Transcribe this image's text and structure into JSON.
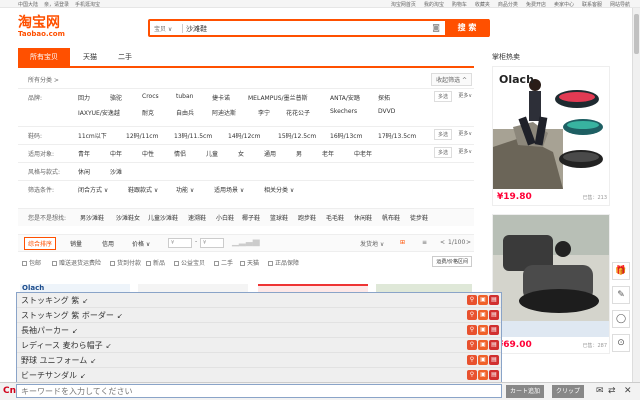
{
  "topbar": {
    "left": [
      "中国大陆",
      "亲，请登录",
      "手机逛淘宝"
    ],
    "right": [
      "淘宝网首页",
      "我的淘宝",
      "购物车",
      "收藏夹",
      "商品分类",
      "免费开店",
      "卖家中心",
      "联系客服",
      "网站导航"
    ]
  },
  "logo": {
    "line1": "淘宝网",
    "line2": "Taobao.com"
  },
  "search": {
    "category": "宝贝",
    "query": "沙滩鞋",
    "button": "搜 索"
  },
  "tabs": [
    {
      "label": "所有宝贝"
    },
    {
      "label": "天猫"
    },
    {
      "label": "二手"
    }
  ],
  "hot": {
    "title": "掌柜热卖"
  },
  "filter": {
    "crumb": "所有分类 >",
    "collapse": "收起筛选 ^",
    "multi": "多选",
    "more": "更多",
    "rows": [
      {
        "label": "品牌:",
        "values": [
          "回力",
          "骆驼",
          "Crocs",
          "tuban",
          "捷卡诺",
          "MELAMPUS/墨兰普斯",
          "ANTA/安踏",
          "探拓"
        ]
      },
      {
        "label": "",
        "values": [
          "IAXYUE/安逸越",
          "耐克",
          "自由兵",
          "阿迪达斯",
          "李宁",
          "花花公子",
          "Skechers",
          "DVVD"
        ]
      },
      {
        "label": "鞋码:",
        "values": [
          "11cm以下",
          "12码/11cm",
          "13码/11.5cm",
          "14码/12cm",
          "15码/12.5cm",
          "16码/13cm",
          "17码/13.5cm"
        ]
      },
      {
        "label": "适用对象:",
        "values": [
          "青年",
          "中年",
          "中性",
          "情侣",
          "儿童",
          "女",
          "通用",
          "男",
          "老年",
          "中老年"
        ]
      },
      {
        "label": "风格与款式:",
        "values": [
          "休闲",
          "沙滩"
        ]
      },
      {
        "label": "筛选条件:",
        "values": [
          "闭合方式 ∨",
          "鞋跟款式 ∨",
          "功能 ∨",
          "适用场景 ∨",
          "相关分类 ∨"
        ]
      },
      {
        "label": "您是不是想找:",
        "values": [
          "男沙滩鞋",
          "沙滩鞋女",
          "儿童沙滩鞋",
          "速溯鞋",
          "小白鞋",
          "椰子鞋",
          "篮球鞋",
          "跑步鞋",
          "毛毛鞋",
          "休闲鞋",
          "帆布鞋",
          "徒步鞋"
        ]
      }
    ]
  },
  "toolbar": {
    "sorts": [
      "综合排序",
      "销量",
      "信用",
      "价格 ∨"
    ],
    "price_from": "¥",
    "price_to": "¥",
    "ship": "发货地 ∨",
    "page": "1/100",
    "prev": "<",
    "next": ">"
  },
  "options": [
    "包邮",
    "赠送退货运费险",
    "货到付款",
    "新品",
    "公益宝贝",
    "二手",
    "天猫",
    "正品保障"
  ],
  "options_button": "运费/价格区间",
  "products": [
    {
      "brand": "Olach",
      "price": "¥19.80",
      "sold": "已售：213"
    },
    {
      "brand": "",
      "price": "¥69.00",
      "sold": "已售：287"
    }
  ],
  "suggestions": [
    {
      "text": "ストッキング 紫"
    },
    {
      "text": "ストッキング 紫 ボーダー"
    },
    {
      "text": "長袖パーカー"
    },
    {
      "text": "レディース 麦わら帽子"
    },
    {
      "text": "野球 ユニフォーム"
    },
    {
      "text": "ビーチサンダル"
    }
  ],
  "ime": {
    "logo": "Cn",
    "placeholder": "キーワードを入力してください",
    "cart": "カート追加",
    "clip": "クリップ"
  },
  "colors": {
    "accent": "#ff5000",
    "price": "#ff0036"
  }
}
